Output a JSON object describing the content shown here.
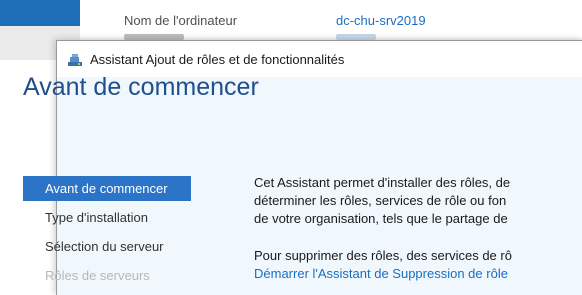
{
  "background": {
    "computer_name_label": "Nom de l'ordinateur",
    "computer_name_value": "dc-chu-srv2019"
  },
  "wizard": {
    "title": "Assistant Ajout de rôles et de fonctionnalités",
    "icon": "server-wizard-icon",
    "heading": "Avant de commencer",
    "nav": [
      {
        "label": "Avant de commencer",
        "state": "active"
      },
      {
        "label": "Type d'installation",
        "state": "normal"
      },
      {
        "label": "Sélection du serveur",
        "state": "normal"
      },
      {
        "label": "Rôles de serveurs",
        "state": "disabled"
      }
    ],
    "content": {
      "line1": "Cet Assistant permet d'installer des rôles, de",
      "line2": "déterminer les rôles, services de rôle ou fon",
      "line3": "de votre organisation, tels que le partage de",
      "line4": "Pour supprimer des rôles, des services de rô",
      "link": "Démarrer l'Assistant de Suppression de rôle"
    }
  },
  "colors": {
    "accent": "#2b74c8",
    "heading": "#1f4f8c",
    "link": "#1a6ec4",
    "header_bg": "#f0f7fd"
  }
}
